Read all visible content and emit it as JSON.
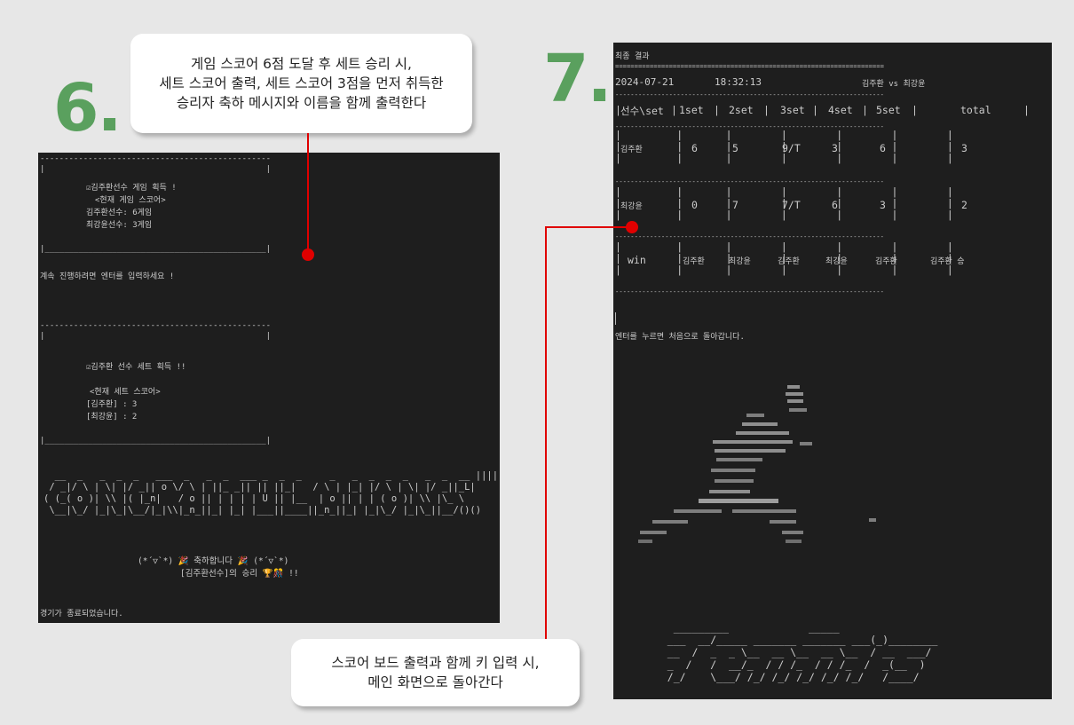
{
  "steps": {
    "six": "6.",
    "seven": "7."
  },
  "callouts": {
    "top": [
      "게임 스코어 6점 도달 후 세트 승리 시,",
      "세트 스코어 출력, 세트 스코어 3점을 먼저 취득한",
      "승리자 축하 메시지와 이름을 함께 출력한다"
    ],
    "bottom": [
      "스코어 보드 출력과 함께 키 입력 시,",
      "메인 화면으로 돌아간다"
    ]
  },
  "left_terminal": {
    "game_box": {
      "border_top": "------------------------------------------------",
      "pipe_line": "|                                              |",
      "bottom": "|______________________________________________|",
      "title": "☑김주환선수 게임 획득 !",
      "subtitle": "<현재 게임 스코어>",
      "score1": "김주환선수: 6게임",
      "score2": "최강윤선수: 3게임"
    },
    "continue_msg": "계속 진행하려면 엔터를 입력하세요 !",
    "set_box": {
      "title": "☑김주환 선수 세트 획득 !!",
      "subtitle": "<현재 세트 스코어>",
      "score1": "[김주환] : 3",
      "score2": "[최강윤] : 2"
    },
    "ascii_congrats": [
      "  __  _   _  _  _   ___  _   _  _  ___ _  _  _     _   _  _  _  _   _  _  __ ||||",
      " / _|/ \\ | \\| |/ _|| o \\/ \\ | ||_ _|| || ||_|   / \\ | |_| |/ \\ | \\| |/ _||_L|",
      "( (_( o )| \\\\ |( |_n|   / o || | | | | U || |__  | o || | | ( o )| \\\\ |\\_ \\",
      " \\__|\\_/ |_|\\_|\\__/|_|\\\\|_n_||_| |_| |___||____||_n_||_| |_|\\_/ |_|\\_||__/()()"
    ],
    "celebrate": "(*´▽`*) 🎉 축하합니다 🎉 (*´▽`*)",
    "winner": "[김주환선수]의 승리 🏆🎊 !!",
    "end_msg": "경기가 종료되었습니다."
  },
  "right_terminal": {
    "header": "최종 결과",
    "separator_eq": "======================================================================",
    "date": "2024-07-21",
    "time": "18:32:13",
    "versus": "김주환 vs 최강윤",
    "dash": "----------------------------------------------------------------------",
    "columns": [
      "선수\\set",
      "1set",
      "2set",
      "3set",
      "4set",
      "5set",
      "total"
    ],
    "rows": [
      {
        "name": "김주환",
        "scores": [
          "6",
          "5",
          "9/T",
          "3",
          "6"
        ],
        "total": "3"
      },
      {
        "name": "최강윤",
        "scores": [
          "0",
          "7",
          "7/T",
          "6",
          "3"
        ],
        "total": "2"
      }
    ],
    "win_row": {
      "label": "win",
      "winners": [
        "김주환",
        "최강윤",
        "김주환",
        "최강윤",
        "김주환"
      ],
      "result": "김주환 승"
    },
    "return_msg": "엔터를 누르면 처음으로 돌아갑니다.",
    "ascii_tennis": [
      "    _________             _____",
      "   ___  __/_____ _______ _______ ___(_)________",
      "   __  /  _  _ \\__  __ \\__  __ \\__  / __  ___/",
      "   _  /   /  __/_  / / /_  / / /_  /  _(__  )",
      "   /_/    \\___/ /_/ /_/ /_/ /_/ /_/   /____/"
    ]
  }
}
